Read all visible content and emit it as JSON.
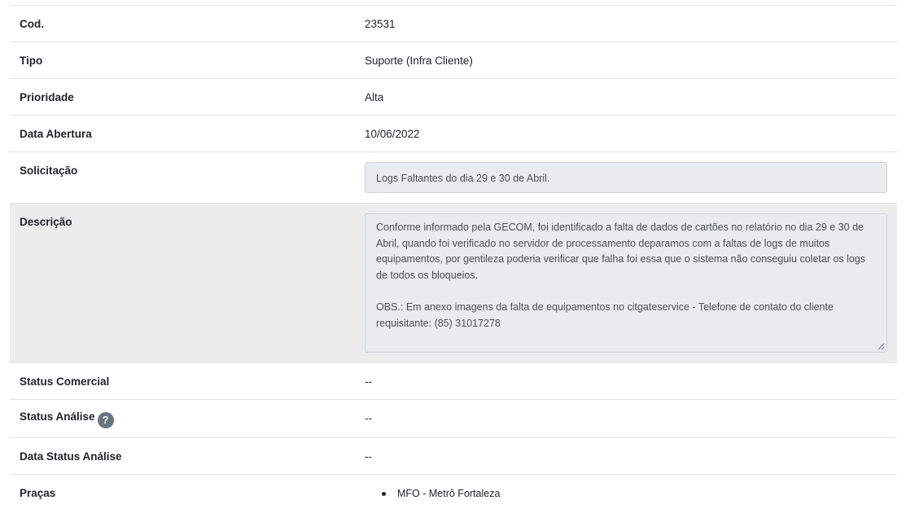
{
  "rows": {
    "cod": {
      "label": "Cod.",
      "value": "23531"
    },
    "tipo": {
      "label": "Tipo",
      "value": "Suporte (Infra Cliente)"
    },
    "prioridade": {
      "label": "Prioridade",
      "value": "Alta"
    },
    "data_abertura": {
      "label": "Data Abertura",
      "value": "10/06/2022"
    },
    "solicitacao": {
      "label": "Solicitação",
      "value": "Logs Faltantes do dia 29 e 30 de Abril."
    },
    "descricao": {
      "label": "Descrição",
      "value": "Conforme informado pela GECOM, foi identificado a falta de dados de cartões no relatório no dia 29 e 30 de Abril, quando foi verificado no servidor de processamento deparamos com a faltas de logs de muitos equipamentos, por gentileza poderia verificar que falha foi essa que o sistema não conseguiu coletar os logs de todos os bloqueios.\n\nOBS.: Em anexo imagens da falta de equipamentos no citgateservice - Telefone de contato do cliente requisitante: (85) 31017278"
    },
    "status_comercial": {
      "label": "Status Comercial",
      "value": "--"
    },
    "status_analise": {
      "label": "Status Análise",
      "value": "--",
      "help_icon": "question-circle-icon"
    },
    "data_status_analise": {
      "label": "Data Status Análise",
      "value": "--"
    },
    "pracas": {
      "label": "Praças",
      "items": [
        "MFO - Metrô Fortaleza"
      ]
    }
  },
  "colors": {
    "shaded_row": "#ececec",
    "field_bg": "#e9ecef",
    "field_border": "#ced4da",
    "help_icon_bg": "#6c757d"
  }
}
